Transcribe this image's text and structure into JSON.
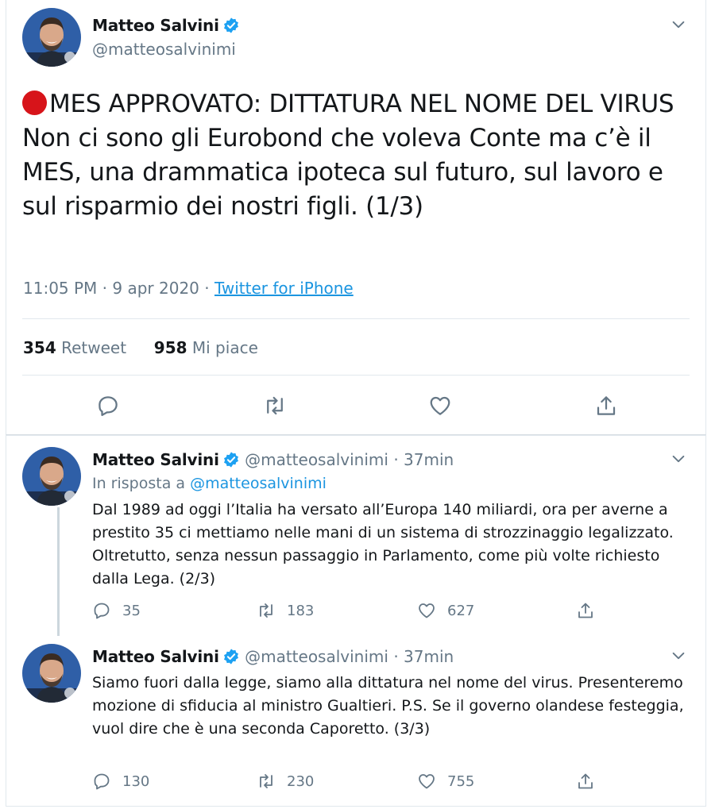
{
  "main_tweet": {
    "author_name": "Matteo Salvini",
    "author_handle": "@matteosalvinimi",
    "text_line_1": "MES APPROVATO: DITTATURA NEL NOME DEL VIRUS",
    "text_line_2": "Non ci sono gli Eurobond che voleva Conte ma c’è il MES, una drammatica ipoteca sul futuro, sul lavoro e sul risparmio dei nostri figli. (1/3)",
    "time": "11:05 PM · 9 apr 2020 · ",
    "source": "Twitter for iPhone",
    "retweet_count": "354",
    "retweet_label": "Retweet",
    "like_count": "958",
    "like_label": "Mi piace"
  },
  "replies": [
    {
      "author_name": "Matteo Salvini",
      "author_handle": "@matteosalvinimi",
      "age": "· 37min",
      "reply_prefix": "In risposta a ",
      "reply_to": "@matteosalvinimi",
      "text": "Dal 1989 ad oggi l’Italia ha versato all’Europa 140 miliardi, ora per averne a prestito 35 ci mettiamo nelle mani di un sistema di strozzinaggio legalizzato. Oltretutto, senza nessun passaggio in Parlamento, come più volte richiesto dalla Lega. (2/3)",
      "replies": "35",
      "retweets": "183",
      "likes": "627"
    },
    {
      "author_name": "Matteo Salvini",
      "author_handle": "@matteosalvinimi",
      "age": "· 37min",
      "text": "Siamo fuori dalla legge, siamo alla dittatura nel nome del virus. Presenteremo mozione di sfiducia al ministro Gualtieri. P.S. Se il governo olandese festeggia, vuol dire che è una seconda Caporetto. (3/3)",
      "replies": "130",
      "retweets": "230",
      "likes": "755"
    }
  ],
  "colors": {
    "link": "#1b95e0",
    "muted": "#657786",
    "verified": "#1da1f2",
    "red_dot": "#d7141a"
  },
  "icons": [
    "verified-badge-icon",
    "chevron-down-icon",
    "reply-icon",
    "retweet-icon",
    "like-icon",
    "share-icon",
    "red-circle-emoji"
  ]
}
